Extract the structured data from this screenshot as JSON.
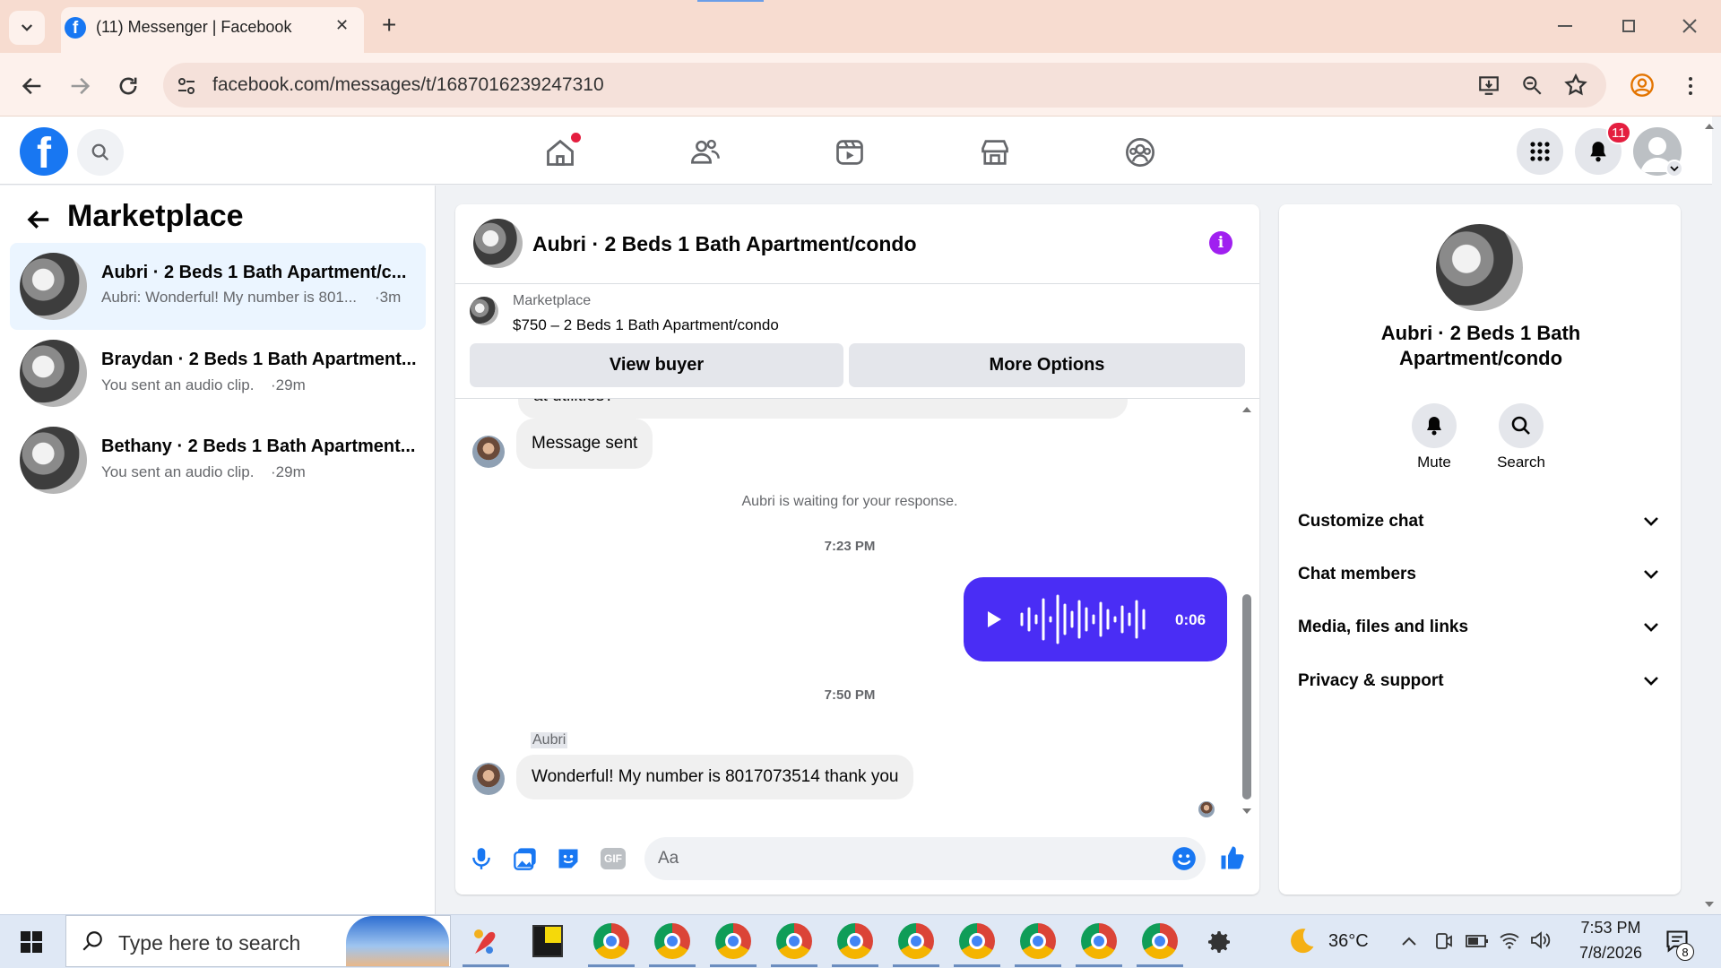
{
  "browser": {
    "tab_title": "(11) Messenger | Facebook",
    "url": "facebook.com/messages/t/1687016239247310",
    "new_tab_glyph": "+",
    "close_glyph": "✕"
  },
  "fb": {
    "notification_count": "11",
    "accent": "#1877f2",
    "nav_icons": [
      "home-icon",
      "friends-icon",
      "watch-icon",
      "marketplace-icon",
      "groups-icon"
    ]
  },
  "sidebar": {
    "title": "Marketplace",
    "conversations": [
      {
        "name": "Aubri · 2 Beds 1 Bath Apartment/c...",
        "preview": "Aubri: Wonderful! My number is 801...",
        "time": "·3m",
        "active": true
      },
      {
        "name": "Braydan · 2 Beds 1 Bath Apartment...",
        "preview": "You sent an audio clip.",
        "time": "·29m",
        "active": false
      },
      {
        "name": "Bethany · 2 Beds 1 Bath Apartment...",
        "preview": "You sent an audio clip.",
        "time": "·29m",
        "active": false
      }
    ]
  },
  "chat": {
    "title": "Aubri · 2 Beds 1 Bath Apartment/condo",
    "listing_source": "Marketplace",
    "listing_title": "$750 – 2 Beds 1 Bath Apartment/condo",
    "view_buyer_label": "View buyer",
    "more_options_label": "More Options",
    "partial_message": "at utilities?",
    "message_sent": "Message sent",
    "waiting_notice": "Aubri is waiting for your response.",
    "time_1": "7:23 PM",
    "audio_duration": "0:06",
    "time_2": "7:50 PM",
    "sender_name": "Aubri",
    "last_message": "Wonderful! My number is 8017073514 thank you",
    "composer_placeholder": "Aa",
    "gif_label": "GIF",
    "audio_color": "#4a2df5"
  },
  "info": {
    "title": "Aubri · 2 Beds 1 Bath Apartment/condo",
    "mute_label": "Mute",
    "search_label": "Search",
    "sections": [
      "Customize chat",
      "Chat members",
      "Media, files and links",
      "Privacy & support"
    ]
  },
  "taskbar": {
    "search_placeholder": "Type here to search",
    "temperature": "36°C",
    "time": "7:53 PM",
    "date": "7/8/2026",
    "notif_count": "8"
  }
}
